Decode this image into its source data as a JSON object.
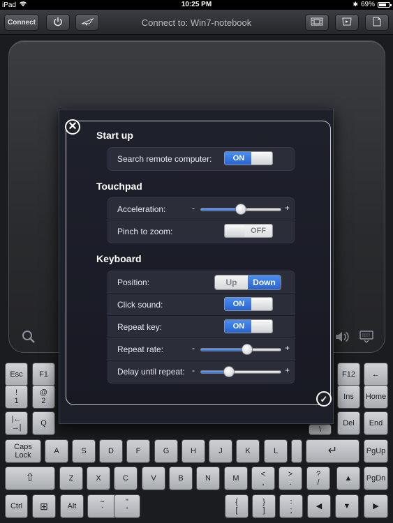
{
  "status_bar": {
    "device": "iPad",
    "time": "10:25 PM",
    "battery": "69%",
    "battery_level": 0.69
  },
  "toolbar": {
    "connect_label": "Connect",
    "title": "Connect to: Win7-notebook",
    "icons": [
      "power-icon",
      "plane-icon",
      "film-icon",
      "presentation-icon",
      "document-icon"
    ]
  },
  "touchpad": {
    "icons": [
      "search-icon",
      "volume-icon",
      "keyboard-icon"
    ]
  },
  "settings": {
    "startup": {
      "title": "Start up",
      "search_label": "Search remote computer:",
      "search_state": "ON"
    },
    "touchpad": {
      "title": "Touchpad",
      "acceleration_label": "Acceleration:",
      "acceleration_value": 0.5,
      "pinch_label": "Pinch to zoom:",
      "pinch_state": "OFF"
    },
    "keyboard": {
      "title": "Keyboard",
      "position_label": "Position:",
      "position_options": [
        "Up",
        "Down"
      ],
      "position_selected": "Down",
      "click_sound_label": "Click sound:",
      "click_sound_state": "ON",
      "repeat_key_label": "Repeat key:",
      "repeat_key_state": "ON",
      "repeat_rate_label": "Repeat rate:",
      "repeat_rate_value": 0.58,
      "delay_label": "Delay until repeat:",
      "delay_value": 0.35
    },
    "slider_minus": "-",
    "slider_plus": "+"
  },
  "keyboard_keys": [
    {
      "label": "Esc"
    },
    {
      "label": "F1"
    },
    {
      "label": "F12"
    },
    {
      "label": "←"
    },
    {
      "label": "!\n1"
    },
    {
      "label": "@\n2"
    },
    {
      "label": "Ins"
    },
    {
      "label": "Home"
    },
    {
      "label": "|←\n→|"
    },
    {
      "label": "Q"
    },
    {
      "label": "\\"
    },
    {
      "label": "Del"
    },
    {
      "label": "End"
    },
    {
      "label": "Caps\nLock"
    },
    {
      "label": "A"
    },
    {
      "label": "S"
    },
    {
      "label": "D"
    },
    {
      "label": "F"
    },
    {
      "label": "G"
    },
    {
      "label": "H"
    },
    {
      "label": "J"
    },
    {
      "label": "K"
    },
    {
      "label": "L"
    },
    {
      "label": ""
    },
    {
      "label": "↵"
    },
    {
      "label": "PgUp"
    },
    {
      "label": "⇧"
    },
    {
      "label": "Z"
    },
    {
      "label": "X"
    },
    {
      "label": "C"
    },
    {
      "label": "V"
    },
    {
      "label": "B"
    },
    {
      "label": "N"
    },
    {
      "label": "M"
    },
    {
      "label": "<\n,"
    },
    {
      "label": ">\n."
    },
    {
      "label": "?\n/"
    },
    {
      "label": "▲"
    },
    {
      "label": "PgDn"
    },
    {
      "label": "Ctrl"
    },
    {
      "label": "⊞"
    },
    {
      "label": "Alt"
    },
    {
      "label": "~\n`"
    },
    {
      "label": "\"\n'"
    },
    {
      "label": "{\n["
    },
    {
      "label": "}\n]"
    },
    {
      "label": ":\n;"
    },
    {
      "label": "◀"
    },
    {
      "label": "▼"
    },
    {
      "label": "▶"
    }
  ]
}
